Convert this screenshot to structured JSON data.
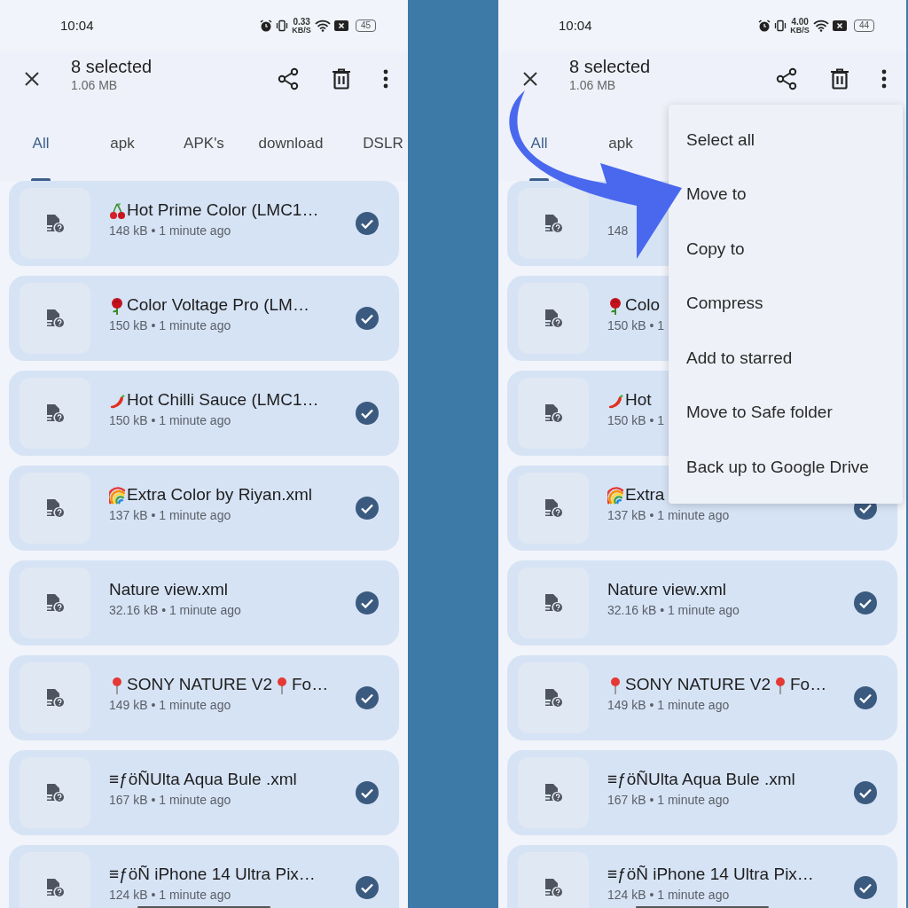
{
  "panels": [
    {
      "status_bar": {
        "time": "10:04",
        "net_speed": "0.33",
        "net_unit": "KB/S",
        "battery": "45"
      },
      "header": {
        "title": "8 selected",
        "subtitle": "1.06 MB"
      },
      "tabs": [
        {
          "label": "All",
          "selected": true
        },
        {
          "label": "apk",
          "selected": false
        },
        {
          "label": "APK's",
          "selected": false
        },
        {
          "label": "download",
          "selected": false
        },
        {
          "label": "DSLR",
          "selected": false
        }
      ],
      "files": [
        {
          "name": [
            {
              "kind": "cherry"
            },
            {
              "kind": "text",
              "text": "Hot Prime Color (LMC1…"
            }
          ],
          "meta": "148 kB • 1 minute ago",
          "checked": true
        },
        {
          "name": [
            {
              "kind": "rose"
            },
            {
              "kind": "text",
              "text": "Color Voltage Pro (LM…"
            }
          ],
          "meta": "150 kB • 1 minute ago",
          "checked": true
        },
        {
          "name": [
            {
              "kind": "chili"
            },
            {
              "kind": "text",
              "text": "Hot Chilli Sauce (LMC1…"
            }
          ],
          "meta": "150 kB • 1 minute ago",
          "checked": true
        },
        {
          "name": [
            {
              "kind": "rainbow"
            },
            {
              "kind": "text",
              "text": "Extra Color by Riyan.xml"
            }
          ],
          "meta": "137 kB • 1 minute ago",
          "checked": true
        },
        {
          "name": [
            {
              "kind": "text",
              "text": "Nature view.xml"
            }
          ],
          "meta": "32.16 kB • 1 minute ago",
          "checked": true
        },
        {
          "name": [
            {
              "kind": "pin"
            },
            {
              "kind": "text",
              "text": "SONY NATURE V2"
            },
            {
              "kind": "pin"
            },
            {
              "kind": "text",
              "text": "Fo…"
            }
          ],
          "meta": "149 kB • 1 minute ago",
          "checked": true
        },
        {
          "name": [
            {
              "kind": "text",
              "text": "≡ƒöÑUlta Aqua Bule .xml"
            }
          ],
          "meta": "167 kB • 1 minute ago",
          "checked": true
        },
        {
          "name": [
            {
              "kind": "text",
              "text": "≡ƒöÑ iPhone 14 Ultra Pix…"
            }
          ],
          "meta": "124 kB • 1 minute ago",
          "checked": true
        }
      ]
    },
    {
      "status_bar": {
        "time": "10:04",
        "net_speed": "4.00",
        "net_unit": "KB/S",
        "battery": "44"
      },
      "header": {
        "title": "8 selected",
        "subtitle": "1.06 MB"
      },
      "tabs": [
        {
          "label": "All",
          "selected": true
        },
        {
          "label": "apk",
          "selected": false
        }
      ],
      "files": [
        {
          "meta": "148"
        },
        {
          "name": [
            {
              "kind": "rose"
            },
            {
              "kind": "text",
              "text": "Colo"
            }
          ],
          "meta": "150 kB • 1"
        },
        {
          "name": [
            {
              "kind": "chili"
            },
            {
              "kind": "text",
              "text": "Hot"
            }
          ],
          "meta": "150 kB • 1"
        },
        {
          "name": [
            {
              "kind": "rainbow"
            },
            {
              "kind": "text",
              "text": "Extra"
            }
          ],
          "meta": "137 kB • 1 minute ago",
          "checked": true
        },
        {
          "name": [
            {
              "kind": "text",
              "text": "Nature view.xml"
            }
          ],
          "meta": "32.16 kB • 1 minute ago",
          "checked": true
        },
        {
          "name": [
            {
              "kind": "pin"
            },
            {
              "kind": "text",
              "text": "SONY NATURE V2"
            },
            {
              "kind": "pin"
            },
            {
              "kind": "text",
              "text": "Fo…"
            }
          ],
          "meta": "149 kB • 1 minute ago",
          "checked": true
        },
        {
          "name": [
            {
              "kind": "text",
              "text": "≡ƒöÑUlta Aqua Bule .xml"
            }
          ],
          "meta": "167 kB • 1 minute ago",
          "checked": true
        },
        {
          "name": [
            {
              "kind": "text",
              "text": "≡ƒöÑ iPhone 14 Ultra Pix…"
            }
          ],
          "meta": "124 kB • 1 minute ago",
          "checked": true
        }
      ],
      "menu": [
        "Select all",
        "Move to",
        "Copy to",
        "Compress",
        "Add to starred",
        "Move to Safe folder",
        "Back up to Google Drive"
      ]
    }
  ]
}
